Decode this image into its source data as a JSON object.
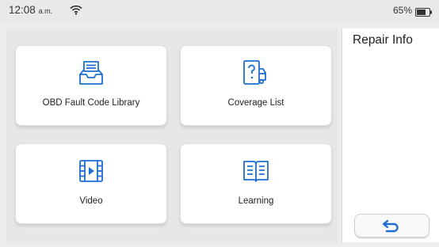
{
  "status_bar": {
    "time": "12:08",
    "ampm": "a.m.",
    "battery": "65%"
  },
  "tiles": [
    {
      "label": "OBD Fault Code Library",
      "icon": "inbox-tray-icon"
    },
    {
      "label": "Coverage List",
      "icon": "question-document-truck-icon"
    },
    {
      "label": "Video",
      "icon": "film-play-icon"
    },
    {
      "label": "Learning",
      "icon": "open-book-icon"
    }
  ],
  "right_panel": {
    "title": "Repair Info",
    "back_icon": "return-arrow-icon"
  },
  "colors": {
    "icon_blue": "#1e6fd0",
    "background": "#ececec"
  }
}
